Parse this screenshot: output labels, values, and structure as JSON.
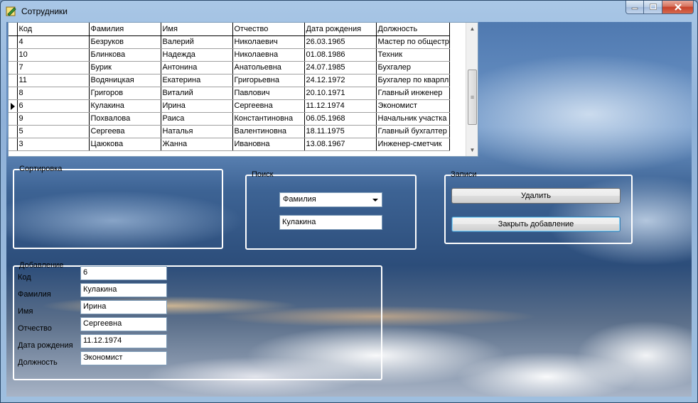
{
  "window": {
    "title": "Сотрудники"
  },
  "grid": {
    "columns": [
      "Код",
      "Фамилия",
      "Имя",
      "Отчество",
      "Дата рождения",
      "Должность"
    ],
    "rows": [
      [
        "4",
        "Безруков",
        "Валерий",
        "Николаевич",
        "26.03.1965",
        "Мастер по общестр"
      ],
      [
        "10",
        "Блинкова",
        "Надежда",
        "Николаевна",
        "01.08.1986",
        "Техник"
      ],
      [
        "7",
        "Бурик",
        "Антонина",
        "Анатольевна",
        "24.07.1985",
        "Бухгалер"
      ],
      [
        "11",
        "Водяницкая",
        "Екатерина",
        "Григорьевна",
        "24.12.1972",
        "Бухгалер по кварпл"
      ],
      [
        "8",
        "Григоров",
        "Виталий",
        "Павлович",
        "20.10.1971",
        "Главный инженер"
      ],
      [
        "6",
        "Кулакина",
        "Ирина",
        "Сергеевна",
        "11.12.1974",
        "Экономист"
      ],
      [
        "9",
        "Похвалова",
        "Раиса",
        "Константиновна",
        "06.05.1968",
        "Начальник участка"
      ],
      [
        "5",
        "Сергеева",
        "Наталья",
        "Валентиновна",
        "18.11.1975",
        "Главный бухгалтер"
      ],
      [
        "3",
        "Цаюкова",
        "Жанна",
        "Ивановна",
        "13.08.1967",
        "Инженер-сметчик"
      ]
    ],
    "current_row": 5
  },
  "sort_group": {
    "title": "Сортировка"
  },
  "search_group": {
    "title": "Поиск",
    "field_selected": "Фамилия",
    "query_value": "Кулакина"
  },
  "records_group": {
    "title": "Записи",
    "delete_label": "Удалить",
    "close_add_label": "Закрыть добавление"
  },
  "add_group": {
    "title": "Добавление",
    "fields": [
      {
        "label": "Код",
        "value": "6"
      },
      {
        "label": "Фамилия",
        "value": "Кулакина"
      },
      {
        "label": "Имя",
        "value": "Ирина"
      },
      {
        "label": "Отчество",
        "value": "Сергеевна"
      },
      {
        "label": "Дата рождения",
        "value": "11.12.1974"
      },
      {
        "label": "Должность",
        "value": "Экономист"
      }
    ]
  }
}
